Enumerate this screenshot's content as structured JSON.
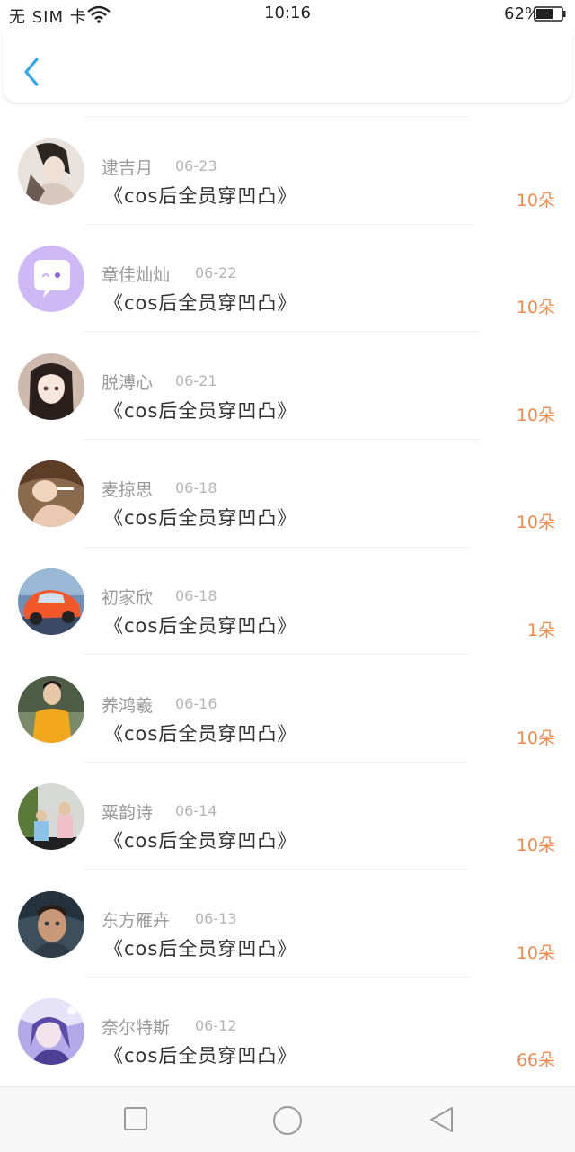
{
  "status_bar": {
    "carrier": "无 SIM 卡",
    "time": "10:16",
    "battery": "62%"
  },
  "nav": {
    "back_icon": "chevron-left-icon",
    "accent_color": "#2aa7f0"
  },
  "list": {
    "items": [
      {
        "name": "逮吉月",
        "date": "06-23",
        "title": "《cos后全员穿凹凸》",
        "amount": "10朵",
        "avatar": "photo-girl-dark-hair"
      },
      {
        "name": "章佳灿灿",
        "date": "06-22",
        "title": "《cos后全员穿凹凸》",
        "amount": "10朵",
        "avatar": "default-chat-bubble"
      },
      {
        "name": "脱溥心",
        "date": "06-21",
        "title": "《cos后全员穿凹凸》",
        "amount": "10朵",
        "avatar": "photo-anime-girl"
      },
      {
        "name": "麦掠思",
        "date": "06-18",
        "title": "《cos后全员穿凹凸》",
        "amount": "10朵",
        "avatar": "photo-girl-smoking"
      },
      {
        "name": "初家欣",
        "date": "06-18",
        "title": "《cos后全员穿凹凸》",
        "amount": "1朵",
        "avatar": "photo-orange-car"
      },
      {
        "name": "养鸿羲",
        "date": "06-16",
        "title": "《cos后全员穿凹凸》",
        "amount": "10朵",
        "avatar": "photo-boy-yellow-shirt"
      },
      {
        "name": "粟韵诗",
        "date": "06-14",
        "title": "《cos后全员穿凹凸》",
        "amount": "10朵",
        "avatar": "photo-two-kids"
      },
      {
        "name": "东方雁卉",
        "date": "06-13",
        "title": "《cos后全员穿凹凸》",
        "amount": "10朵",
        "avatar": "photo-man-portrait"
      },
      {
        "name": "奈尔特斯",
        "date": "06-12",
        "title": "《cos后全员穿凹凸》",
        "amount": "66朵",
        "avatar": "photo-anime-purple"
      }
    ],
    "amount_color": "#f08a4b"
  },
  "bottom_nav": {
    "icons": [
      "square-icon",
      "circle-icon",
      "triangle-back-icon"
    ]
  }
}
